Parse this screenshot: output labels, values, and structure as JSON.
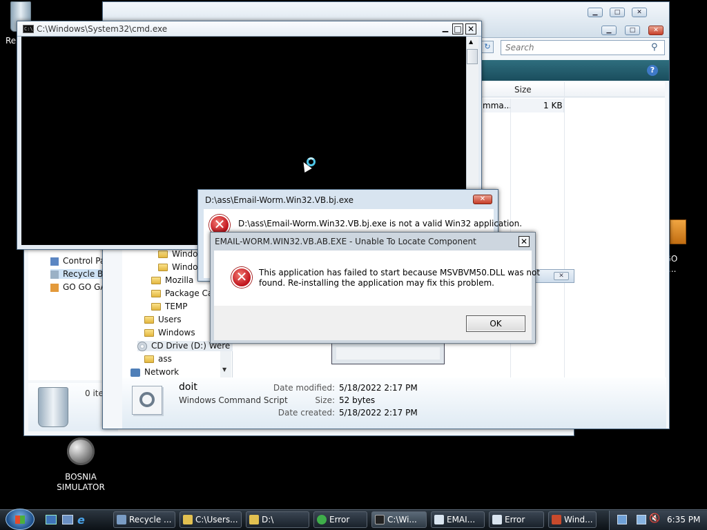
{
  "desktop": {
    "recycle_label_top": "Re",
    "bosnia_label": "BOSNIA\nSIMULATOR",
    "go_go_label": "GO GO\nGET ..."
  },
  "explorer_back": {
    "items": [
      "Control Pa",
      "Recycle Bir",
      "GO GO GA"
    ],
    "count": "0 ite"
  },
  "explorer_front": {
    "search_placeholder": "Search",
    "column_size": "Size",
    "row_name": "mma...",
    "row_size": "1 KB",
    "tree": [
      "Windo",
      "Windo",
      "Mozilla",
      "Package Ca",
      "TEMP",
      "Users",
      "Windows",
      "CD Drive (D:) Were",
      "ass",
      "Network"
    ],
    "details": {
      "name": "doit",
      "type": "Windows Command Script",
      "modified_label": "Date modified:",
      "modified": "5/18/2022 2:17 PM",
      "size_label": "Size:",
      "size": "52 bytes",
      "created_label": "Date created:",
      "created": "5/18/2022 2:17 PM"
    }
  },
  "cmd": {
    "title": "C:\\Windows\\System32\\cmd.exe",
    "icon_text": "C:\\."
  },
  "dialog1": {
    "title": "D:\\ass\\Email-Worm.Win32.VB.bj.exe",
    "message": "D:\\ass\\Email-Worm.Win32.VB.bj.exe is not a valid Win32 application."
  },
  "dialog2": {
    "title": "EMAIL-WORM.WIN32.VB.AB.EXE - Unable To Locate Component",
    "message_line1": "This application has failed to start because MSVBVM50.DLL was not",
    "message_line2": "found. Re-installing the application may fix this problem.",
    "ok": "OK"
  },
  "taskbar": {
    "buttons": [
      {
        "label": "Recycle ...",
        "color": "#7a9cc4"
      },
      {
        "label": "C:\\Users...",
        "color": "#e2c050"
      },
      {
        "label": "D:\\",
        "color": "#e2c050"
      },
      {
        "label": "Error",
        "color": "#3fae4a"
      },
      {
        "label": "C:\\Wi...",
        "color": "#222222"
      },
      {
        "label": "EMAI...",
        "color": "#d9e4ef"
      },
      {
        "label": "Error",
        "color": "#d9e4ef"
      },
      {
        "label": "Wind...",
        "color": "#c84a2c"
      }
    ],
    "clock": "6:35 PM"
  }
}
